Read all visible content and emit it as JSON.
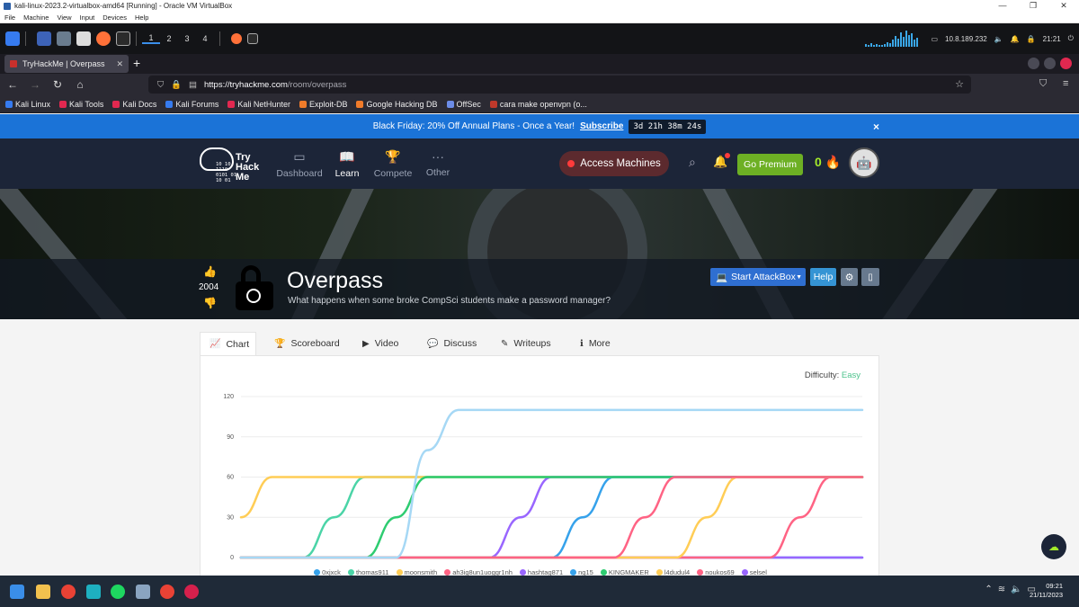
{
  "vbox": {
    "window_title": "kali-linux-2023.2-virtualbox-amd64 [Running] - Oracle VM VirtualBox",
    "menu": [
      "File",
      "Machine",
      "View",
      "Input",
      "Devices",
      "Help"
    ],
    "controls": [
      "—",
      "❐",
      "✕"
    ]
  },
  "kali_panel": {
    "workspaces": [
      "1",
      "2",
      "3",
      "4"
    ],
    "ip": "10.8.189.232",
    "time": "21:21"
  },
  "browser": {
    "tab_title": "TryHackMe | Overpass",
    "url_host": "https://tryhackme.com",
    "url_path": "/room/overpass",
    "bookmarks": [
      {
        "label": "Kali Linux",
        "color": "#367bf0"
      },
      {
        "label": "Kali Tools",
        "color": "#e22850"
      },
      {
        "label": "Kali Docs",
        "color": "#e22850"
      },
      {
        "label": "Kali Forums",
        "color": "#367bf0"
      },
      {
        "label": "Kali NetHunter",
        "color": "#e22850"
      },
      {
        "label": "Exploit-DB",
        "color": "#f07b2a"
      },
      {
        "label": "Google Hacking DB",
        "color": "#f07b2a"
      },
      {
        "label": "OffSec",
        "color": "#6c8ce8"
      },
      {
        "label": "cara make openvpn (o...",
        "color": "#c0392b"
      }
    ]
  },
  "promo": {
    "text": "Black Friday: 20% Off Annual Plans - Once a Year!",
    "link": "Subscribe",
    "timer": "3d 21h 38m 24s",
    "close": "×"
  },
  "thm": {
    "logo_word_1": "Try",
    "logo_word_2": "Hack",
    "logo_word_3": "Me",
    "logo_bits": "10 10\n1110\n0101 01\n10 01",
    "nav": [
      {
        "label": "Dashboard",
        "icon": "▭"
      },
      {
        "label": "Learn",
        "icon": "📖"
      },
      {
        "label": "Compete",
        "icon": "🏆"
      },
      {
        "label": "Other",
        "icon": "···"
      }
    ],
    "access_machines": "Access Machines",
    "go_premium": "Go Premium",
    "streak": "0"
  },
  "room": {
    "title": "Overpass",
    "subtitle": "What happens when some broke CompSci students make a password manager?",
    "votes": "2004",
    "start_attackbox": "Start AttackBox",
    "help": "Help"
  },
  "tabs": [
    {
      "label": "Chart",
      "icon": "📈"
    },
    {
      "label": "Scoreboard",
      "icon": "🏆"
    },
    {
      "label": "Video",
      "icon": "▶"
    },
    {
      "label": "Discuss",
      "icon": "💬"
    },
    {
      "label": "Writeups",
      "icon": "✎"
    },
    {
      "label": "More",
      "icon": "ℹ"
    }
  ],
  "difficulty": {
    "label": "Difficulty:",
    "value": "Easy"
  },
  "chart_data": {
    "type": "line",
    "title": "",
    "xlabel": "",
    "ylabel": "",
    "ylim": [
      0,
      120
    ],
    "yticks": [
      "0",
      "30",
      "60",
      "90",
      "120"
    ],
    "grid": true,
    "legend_position": "bottom",
    "x": [
      0,
      1,
      2,
      3,
      4,
      5,
      6,
      7,
      8,
      9,
      10,
      11,
      12,
      13,
      14,
      15,
      16,
      17,
      18,
      19,
      20
    ],
    "series": [
      {
        "name": "0xjxck",
        "color": "#36a2eb",
        "values": [
          0,
          0,
          0,
          0,
          0,
          0,
          0,
          0,
          0,
          0,
          0,
          0,
          0,
          0,
          0,
          0,
          0,
          0,
          0,
          0,
          0
        ]
      },
      {
        "name": "thomas911",
        "color": "#4bd4a7",
        "values": [
          0,
          0,
          0,
          30,
          60,
          60,
          60,
          60,
          60,
          60,
          60,
          60,
          60,
          60,
          60,
          60,
          60,
          60,
          60,
          60,
          60
        ]
      },
      {
        "name": "moonsmith",
        "color": "#ffcd56",
        "values": [
          30,
          60,
          60,
          60,
          60,
          60,
          60,
          60,
          60,
          60,
          60,
          60,
          60,
          60,
          60,
          60,
          60,
          60,
          60,
          60,
          60
        ]
      },
      {
        "name": "ah3ig8un1uoggr1nh",
        "color": "#ff6384",
        "values": [
          0,
          0,
          0,
          0,
          0,
          0,
          0,
          0,
          0,
          0,
          0,
          0,
          0,
          0,
          0,
          0,
          0,
          0,
          30,
          60,
          60
        ]
      },
      {
        "name": "hashtag871",
        "color": "#9966ff",
        "values": [
          0,
          0,
          0,
          0,
          0,
          0,
          0,
          0,
          0,
          30,
          60,
          60,
          60,
          60,
          60,
          60,
          60,
          60,
          60,
          60,
          60
        ]
      },
      {
        "name": "ng15",
        "color": "#36a2eb",
        "values": [
          0,
          0,
          0,
          0,
          0,
          0,
          0,
          0,
          0,
          0,
          0,
          30,
          60,
          60,
          60,
          60,
          60,
          60,
          60,
          60,
          60
        ]
      },
      {
        "name": "KINGMAKER",
        "color": "#2ecc71",
        "values": [
          0,
          0,
          0,
          0,
          0,
          30,
          60,
          60,
          60,
          60,
          60,
          60,
          60,
          60,
          60,
          60,
          60,
          60,
          60,
          60,
          60
        ]
      },
      {
        "name": "l4dudul4",
        "color": "#ffcd56",
        "values": [
          0,
          0,
          0,
          0,
          0,
          0,
          0,
          0,
          0,
          0,
          0,
          0,
          0,
          0,
          0,
          30,
          60,
          60,
          60,
          60,
          60
        ]
      },
      {
        "name": "noukos69",
        "color": "#ff6384",
        "values": [
          0,
          0,
          0,
          0,
          0,
          0,
          0,
          0,
          0,
          0,
          0,
          0,
          0,
          30,
          60,
          60,
          60,
          60,
          60,
          60,
          60
        ]
      },
      {
        "name": "selsel",
        "color": "#9966ff",
        "values": [
          0,
          0,
          0,
          0,
          0,
          0,
          0,
          0,
          0,
          0,
          0,
          0,
          0,
          0,
          0,
          0,
          0,
          0,
          0,
          0,
          0
        ]
      },
      {
        "name": "",
        "color": "#a6d8f5",
        "values": [
          0,
          0,
          0,
          0,
          0,
          0,
          80,
          110,
          110,
          110,
          110,
          110,
          110,
          110,
          110,
          110,
          110,
          110,
          110,
          110,
          110
        ]
      }
    ]
  },
  "taskbar": {
    "time": "09:21",
    "date": "21/11/2023"
  },
  "colors": {
    "thm_nav": "#1c2538",
    "accent_green": "#a3ea2a",
    "promo_blue": "#1b73d7",
    "attackbox_blue": "#2f6fd1"
  }
}
